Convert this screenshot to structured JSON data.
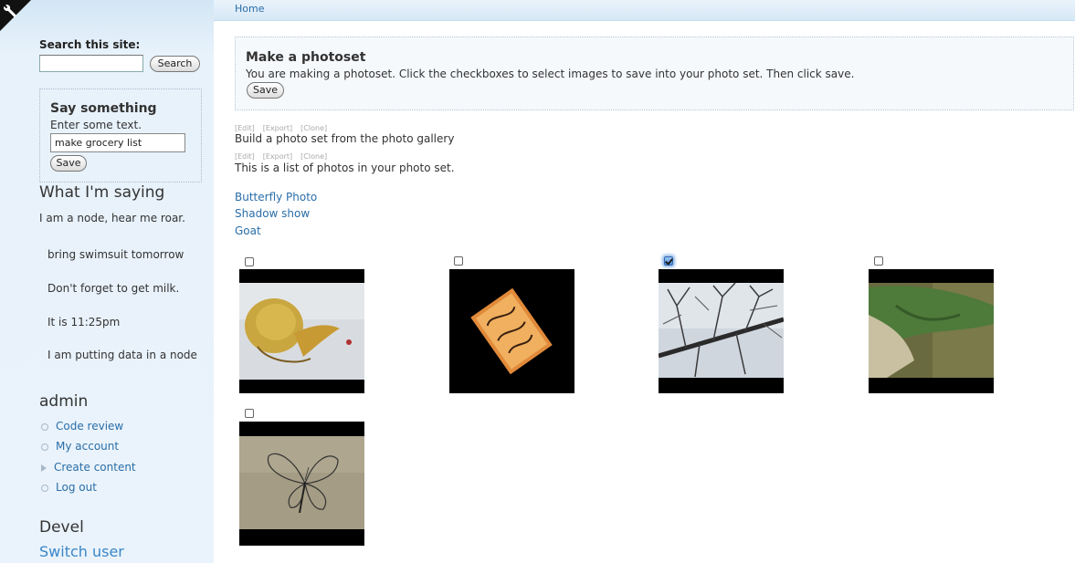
{
  "sidebar": {
    "search_label": "Search this site:",
    "search_value": "",
    "search_button": "Search",
    "say_block": {
      "title": "Say something",
      "help": "Enter some text.",
      "input_value": "make grocery list",
      "save_label": "Save"
    },
    "saying_heading": "What I'm saying",
    "saying_intro": "I am a node, hear me roar.",
    "saying_items": [
      "bring swimsuit tomorrow",
      "Don't forget to get milk.",
      "It is 11:25pm",
      "I am putting data in a node"
    ],
    "admin_heading": "admin",
    "admin_menu": [
      "Code review",
      "My account",
      "Create content",
      "Log out"
    ],
    "devel_heading": "Devel",
    "switch_user": "Switch user"
  },
  "topbar": {
    "home": "Home"
  },
  "photoset": {
    "title": "Make a photoset",
    "description": "You are making a photoset. Click the checkboxes to select images to save into your photo set. Then click save.",
    "save_label": "Save"
  },
  "admin_links": [
    "[Edit]",
    "[Export]",
    "[Clone]"
  ],
  "view_header_1": "Build a photo set from the photo gallery",
  "view_header_2": "This is a list of photos in your photo set.",
  "photo_links": [
    "Butterfly Photo",
    "Shadow show",
    "Goat"
  ],
  "gallery": [
    {
      "name": "gallery-photo-fish-drawing",
      "checked": false
    },
    {
      "name": "gallery-photo-comic-book",
      "checked": false
    },
    {
      "name": "gallery-photo-bare-tree",
      "checked": true
    },
    {
      "name": "gallery-photo-green-cloth",
      "checked": false
    },
    {
      "name": "gallery-photo-butterfly-sketch",
      "checked": false
    }
  ],
  "colors": {
    "link": "#2a6ea8",
    "sidebar_bg": "#e8f2fb",
    "checked": "#4a8ee0"
  }
}
